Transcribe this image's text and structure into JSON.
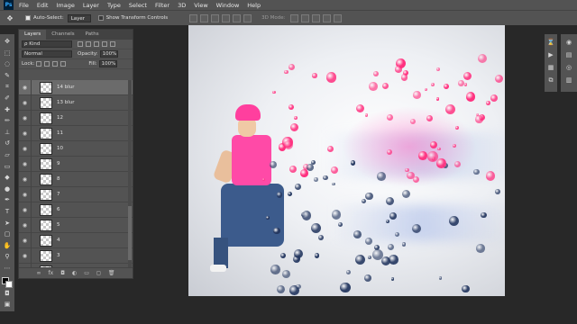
{
  "app": {
    "logo": "Ps"
  },
  "menu": [
    "File",
    "Edit",
    "Image",
    "Layer",
    "Type",
    "Select",
    "Filter",
    "3D",
    "View",
    "Window",
    "Help"
  ],
  "options": {
    "auto_select_label": "Auto-Select:",
    "auto_select_value": "Layer",
    "show_transform_label": "Show Transform Controls",
    "mode3d_label": "3D Mode:"
  },
  "layers_panel": {
    "tabs": [
      "Layers",
      "Channels",
      "Paths"
    ],
    "kind_filter": "ρ Kind",
    "blend_mode": "Normal",
    "opacity_label": "Opacity:",
    "opacity_value": "100%",
    "lock_label": "Lock:",
    "fill_label": "Fill:",
    "fill_value": "100%",
    "layers": [
      {
        "name": "14 blur"
      },
      {
        "name": "13 blur"
      },
      {
        "name": "12"
      },
      {
        "name": "11"
      },
      {
        "name": "10"
      },
      {
        "name": "9"
      },
      {
        "name": "8"
      },
      {
        "name": "7"
      },
      {
        "name": "6"
      },
      {
        "name": "5"
      },
      {
        "name": "4"
      },
      {
        "name": "3"
      },
      {
        "name": "2"
      }
    ],
    "selected_index": 0
  },
  "colors": {
    "ui_bg": "#535353",
    "workspace": "#282828",
    "hat": "#ff3f9e",
    "bubble_pink": "#ff2f7e",
    "bubble_blue": "#23365f"
  }
}
